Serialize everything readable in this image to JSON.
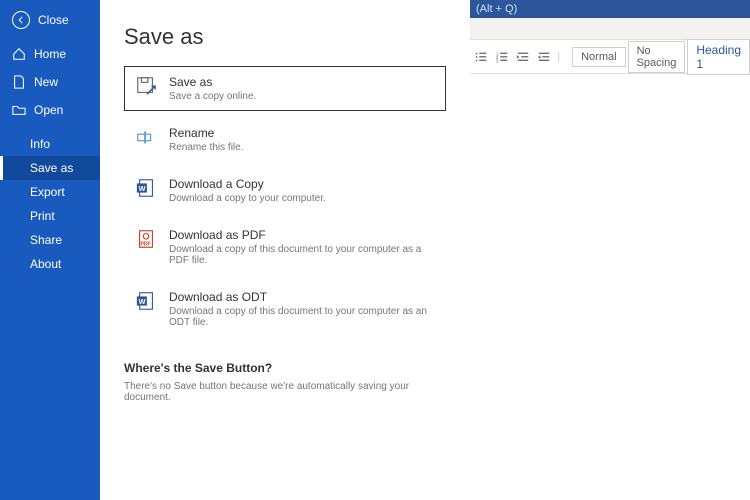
{
  "titlebar_hint": "(Alt + Q)",
  "sidebar": {
    "close": "Close",
    "home": "Home",
    "new": "New",
    "open": "Open",
    "info": "Info",
    "save_as": "Save as",
    "export": "Export",
    "print": "Print",
    "share": "Share",
    "about": "About"
  },
  "panel": {
    "heading": "Save as",
    "options": {
      "save_as": {
        "title": "Save as",
        "desc": "Save a copy online."
      },
      "rename": {
        "title": "Rename",
        "desc": "Rename this file."
      },
      "download_copy": {
        "title": "Download a Copy",
        "desc": "Download a copy to your computer."
      },
      "download_pdf": {
        "title": "Download as PDF",
        "desc": "Download a copy of this document to your computer as a PDF file."
      },
      "download_odt": {
        "title": "Download as ODT",
        "desc": "Download a copy of this document to your computer as an ODT file."
      }
    },
    "note_heading": "Where's the Save Button?",
    "note_body": "There's no Save button because we're automatically saving your document."
  },
  "ribbon": {
    "styles": {
      "normal": "Normal",
      "no_spacing": "No Spacing",
      "heading1": "Heading 1"
    }
  }
}
